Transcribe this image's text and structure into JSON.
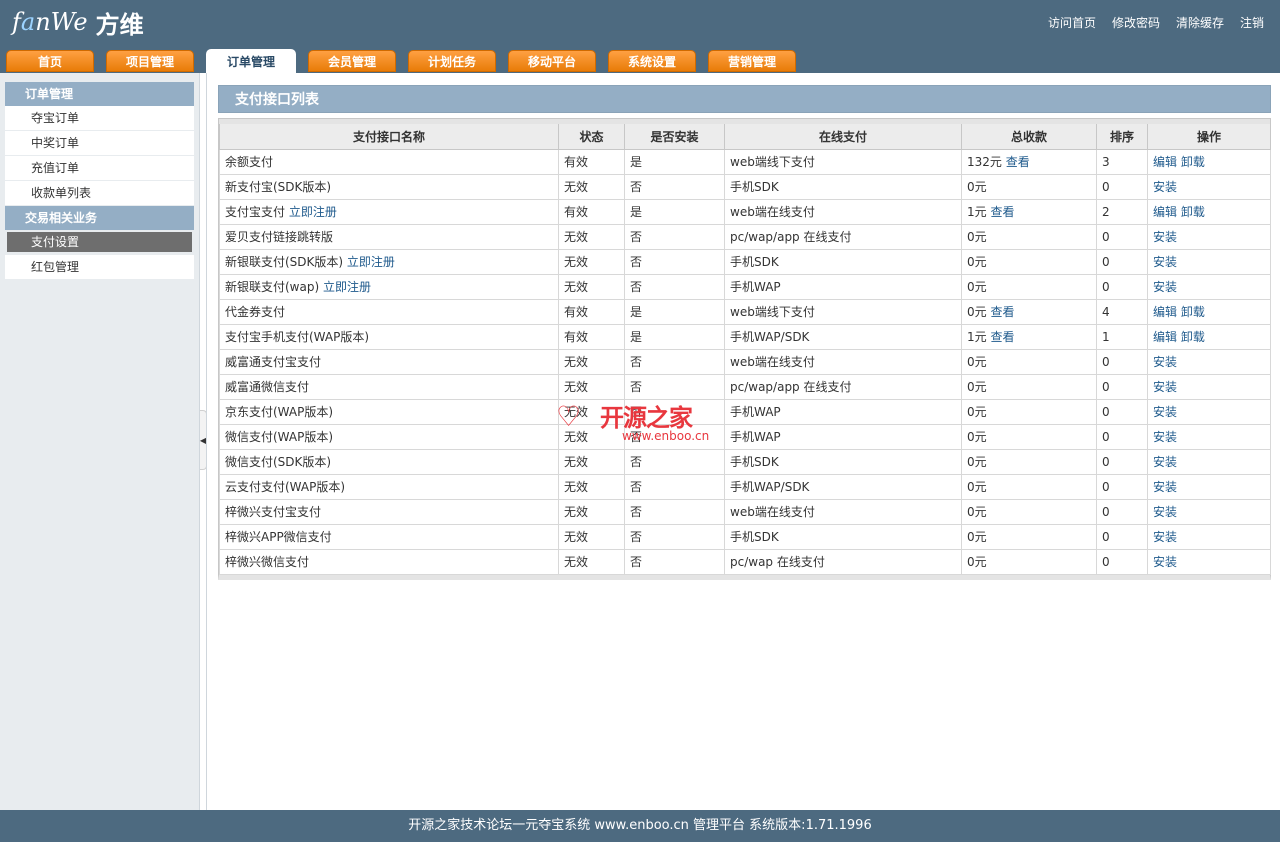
{
  "header": {
    "logo_en_prefix": "f",
    "logo_en_accent": "a",
    "logo_en_suffix": "nWe",
    "logo_cn": "方维",
    "links": [
      "访问首页",
      "修改密码",
      "清除缓存",
      "注销"
    ]
  },
  "nav": {
    "tabs": [
      "首页",
      "项目管理",
      "订单管理",
      "会员管理",
      "计划任务",
      "移动平台",
      "系统设置",
      "营销管理"
    ],
    "active": "订单管理"
  },
  "sidebar": {
    "groups": [
      {
        "title": "订单管理",
        "items": [
          "夺宝订单",
          "中奖订单",
          "充值订单",
          "收款单列表"
        ]
      },
      {
        "title": "交易相关业务",
        "items": [
          "支付设置",
          "红包管理"
        ]
      }
    ],
    "active_item": "支付设置"
  },
  "panel": {
    "title": "支付接口列表"
  },
  "table": {
    "headers": [
      "支付接口名称",
      "状态",
      "是否安装",
      "在线支付",
      "总收款",
      "排序",
      "操作"
    ],
    "rows": [
      {
        "name": "余额支付",
        "register": "",
        "status": "有效",
        "installed": "是",
        "online": "web端线下支付",
        "total": "132元",
        "view": "查看",
        "sort": "3",
        "ops": [
          "编辑",
          "卸载"
        ]
      },
      {
        "name": "新支付宝(SDK版本)",
        "register": "",
        "status": "无效",
        "installed": "否",
        "online": "手机SDK",
        "total": "0元",
        "view": "",
        "sort": "0",
        "ops": [
          "安装"
        ]
      },
      {
        "name": "支付宝支付",
        "register": "立即注册",
        "status": "有效",
        "installed": "是",
        "online": "web端在线支付",
        "total": "1元",
        "view": "查看",
        "sort": "2",
        "ops": [
          "编辑",
          "卸载"
        ]
      },
      {
        "name": "爱贝支付链接跳转版",
        "register": "",
        "status": "无效",
        "installed": "否",
        "online": "pc/wap/app 在线支付",
        "total": "0元",
        "view": "",
        "sort": "0",
        "ops": [
          "安装"
        ]
      },
      {
        "name": "新银联支付(SDK版本)",
        "register": "立即注册",
        "status": "无效",
        "installed": "否",
        "online": "手机SDK",
        "total": "0元",
        "view": "",
        "sort": "0",
        "ops": [
          "安装"
        ]
      },
      {
        "name": "新银联支付(wap)",
        "register": "立即注册",
        "status": "无效",
        "installed": "否",
        "online": "手机WAP",
        "total": "0元",
        "view": "",
        "sort": "0",
        "ops": [
          "安装"
        ]
      },
      {
        "name": "代金券支付",
        "register": "",
        "status": "有效",
        "installed": "是",
        "online": "web端线下支付",
        "total": "0元",
        "view": "查看",
        "sort": "4",
        "ops": [
          "编辑",
          "卸载"
        ]
      },
      {
        "name": "支付宝手机支付(WAP版本)",
        "register": "",
        "status": "有效",
        "installed": "是",
        "online": "手机WAP/SDK",
        "total": "1元",
        "view": "查看",
        "sort": "1",
        "ops": [
          "编辑",
          "卸载"
        ]
      },
      {
        "name": "威富通支付宝支付",
        "register": "",
        "status": "无效",
        "installed": "否",
        "online": "web端在线支付",
        "total": "0元",
        "view": "",
        "sort": "0",
        "ops": [
          "安装"
        ]
      },
      {
        "name": "威富通微信支付",
        "register": "",
        "status": "无效",
        "installed": "否",
        "online": "pc/wap/app 在线支付",
        "total": "0元",
        "view": "",
        "sort": "0",
        "ops": [
          "安装"
        ]
      },
      {
        "name": "京东支付(WAP版本)",
        "register": "",
        "status": "无效",
        "installed": "否",
        "online": "手机WAP",
        "total": "0元",
        "view": "",
        "sort": "0",
        "ops": [
          "安装"
        ]
      },
      {
        "name": "微信支付(WAP版本)",
        "register": "",
        "status": "无效",
        "installed": "否",
        "online": "手机WAP",
        "total": "0元",
        "view": "",
        "sort": "0",
        "ops": [
          "安装"
        ]
      },
      {
        "name": "微信支付(SDK版本)",
        "register": "",
        "status": "无效",
        "installed": "否",
        "online": "手机SDK",
        "total": "0元",
        "view": "",
        "sort": "0",
        "ops": [
          "安装"
        ]
      },
      {
        "name": "云支付支付(WAP版本)",
        "register": "",
        "status": "无效",
        "installed": "否",
        "online": "手机WAP/SDK",
        "total": "0元",
        "view": "",
        "sort": "0",
        "ops": [
          "安装"
        ]
      },
      {
        "name": "梓微兴支付宝支付",
        "register": "",
        "status": "无效",
        "installed": "否",
        "online": "web端在线支付",
        "total": "0元",
        "view": "",
        "sort": "0",
        "ops": [
          "安装"
        ]
      },
      {
        "name": "梓微兴APP微信支付",
        "register": "",
        "status": "无效",
        "installed": "否",
        "online": "手机SDK",
        "total": "0元",
        "view": "",
        "sort": "0",
        "ops": [
          "安装"
        ]
      },
      {
        "name": "梓微兴微信支付",
        "register": "",
        "status": "无效",
        "installed": "否",
        "online": "pc/wap 在线支付",
        "total": "0元",
        "view": "",
        "sort": "0",
        "ops": [
          "安装"
        ]
      }
    ]
  },
  "watermark": {
    "heart": "♡",
    "title": "开源之家",
    "url": "www.enboo.cn"
  },
  "footer": {
    "text": "开源之家技术论坛一元夺宝系统 www.enboo.cn 管理平台 系统版本:1.71.1996"
  },
  "colors": {
    "header_bg": "#4d6a80",
    "tab_orange": "#f08c1e",
    "panel_head": "#94aec5",
    "link_blue": "#1f5a8c",
    "watermark_red": "#e8373e"
  }
}
